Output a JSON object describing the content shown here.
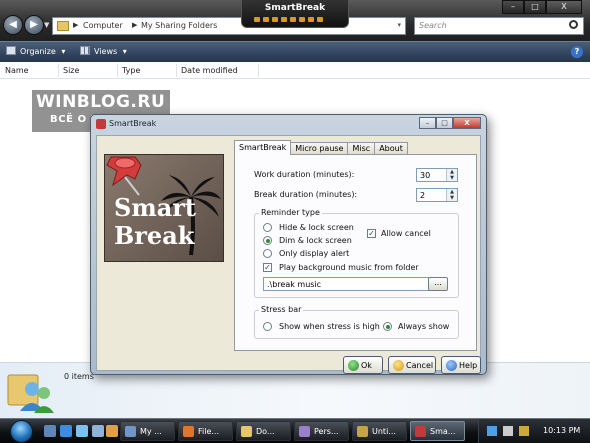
{
  "explorer": {
    "nav": {
      "back": "◀",
      "forward": "▶",
      "dropdown": "▼"
    },
    "address": {
      "root_sep": "▶",
      "part1": "Computer",
      "sep": "▶",
      "part2": "My Sharing Folders",
      "dropdown": "▾"
    },
    "search_placeholder": "Search",
    "window_buttons": {
      "minimize": "–",
      "maximize": "□",
      "close": "X"
    },
    "toolbar": {
      "organize": "Organize",
      "views": "Views",
      "arrow": "▾",
      "help": "?"
    },
    "columns": [
      "Name",
      "Size",
      "Type",
      "Date modified"
    ],
    "status": "0 items"
  },
  "smartbreak_widget": {
    "title": "SmartBreak",
    "led_count": 8
  },
  "watermark": {
    "line1": "WINBLOG.RU",
    "line2": "ВСЁ О WINDOWS"
  },
  "dialog": {
    "title": "SmartBreak",
    "window_buttons": {
      "minimize": "–",
      "maximize": "□",
      "close": "X"
    },
    "logo": {
      "line1": "Smart",
      "line2": "Break"
    },
    "tabs": [
      "SmartBreak",
      "Micro pause",
      "Misc",
      "About"
    ],
    "active_tab": "SmartBreak",
    "work_duration": {
      "label": "Work duration (minutes):",
      "value": "30"
    },
    "break_duration": {
      "label": "Break duration (minutes):",
      "value": "2"
    },
    "spin_up": "▲",
    "spin_down": "▼",
    "reminder": {
      "title": "Reminder type",
      "options": [
        "Hide & lock screen",
        "Dim & lock screen",
        "Only display alert"
      ],
      "selected": "Dim & lock screen",
      "allow_cancel": {
        "label": "Allow cancel",
        "checked": true
      },
      "music": {
        "label": "Play background music from folder",
        "checked": true
      },
      "folder": ".\\break music",
      "browse": "...",
      "check_mark": "✓"
    },
    "stress_bar": {
      "title": "Stress bar",
      "options": [
        "Show when stress is high",
        "Always show"
      ],
      "selected": "Always show"
    },
    "buttons": {
      "ok": "Ok",
      "cancel": "Cancel",
      "help": "Help"
    }
  },
  "taskbar": {
    "tasks": [
      {
        "label": "My ...",
        "icon_color": "#6f96c9",
        "active": false
      },
      {
        "label": "File...",
        "icon_color": "#e0762b",
        "active": false
      },
      {
        "label": "Do...",
        "icon_color": "#e7c66b",
        "active": false
      },
      {
        "label": "Pers...",
        "icon_color": "#9a7fc9",
        "active": false
      },
      {
        "label": "Unti...",
        "icon_color": "#c7a24a",
        "active": false
      },
      {
        "label": "Sma...",
        "icon_color": "#c43a3a",
        "active": true
      }
    ],
    "clock": "10:13 PM"
  }
}
